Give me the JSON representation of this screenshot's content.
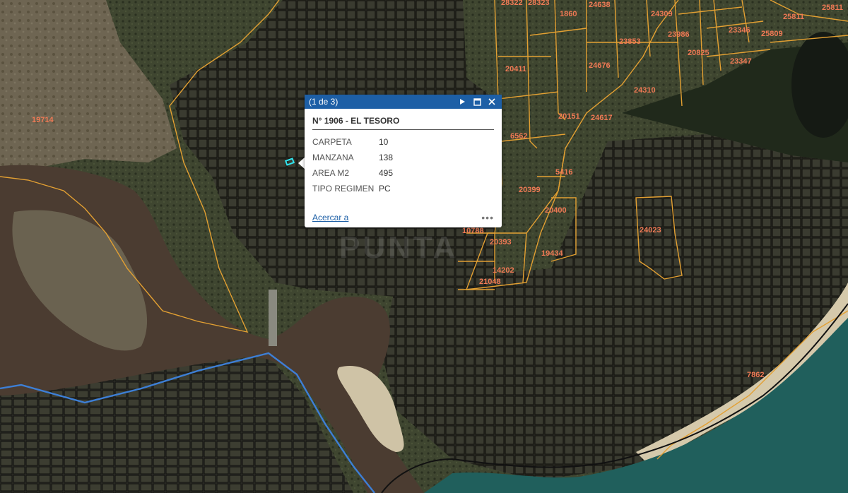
{
  "map": {
    "colors": {
      "land": "#33352a",
      "urban": "#26261f",
      "river": "#4a3a30",
      "sea": "#1f5e5c",
      "beach": "#d9ccae",
      "parcel_line": "#e3a032",
      "road_line": "#3d7fd6"
    },
    "parcel_labels": [
      "28322",
      "28323",
      "1860",
      "24638",
      "24309",
      "25811",
      "25811",
      "23346",
      "25809",
      "23986",
      "23853",
      "20825",
      "23347",
      "20411",
      "24676",
      "24310",
      "20151",
      "24617",
      "6562",
      "19714",
      "5416",
      "20399",
      "20400",
      "24023",
      "10788",
      "20393",
      "19434",
      "14202",
      "21048",
      "7862"
    ],
    "watermark": "PUNTA"
  },
  "popup": {
    "counter": "(1 de 3)",
    "title": "N° 1906 - EL TESORO",
    "attributes": [
      {
        "key": "CARPETA",
        "value": "10"
      },
      {
        "key": "MANZANA",
        "value": "138"
      },
      {
        "key": "AREA M2",
        "value": "495"
      },
      {
        "key": "TIPO REGIMEN",
        "value": "PC"
      }
    ],
    "zoom_link": "Acercar a",
    "more_label": "•••"
  }
}
